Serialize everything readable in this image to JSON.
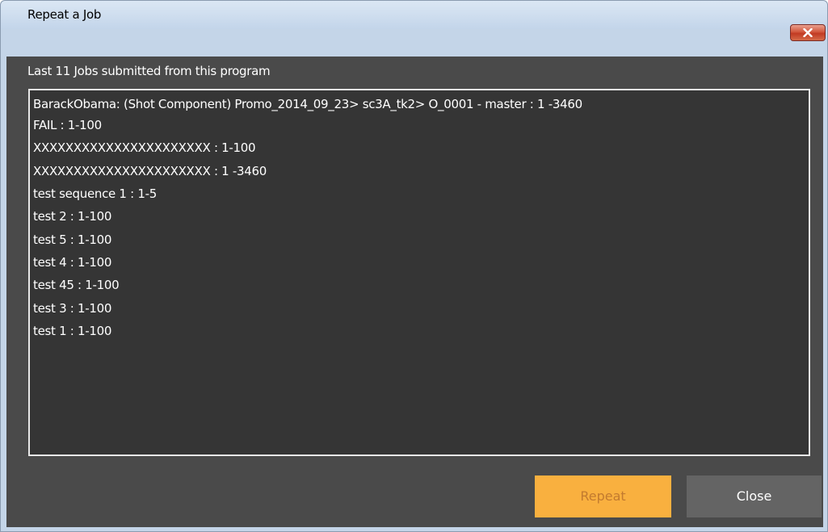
{
  "window": {
    "title": "Repeat a Job",
    "close_icon": "close-x-icon"
  },
  "header": {
    "label": "Last 11 Jobs submitted from this program"
  },
  "jobs": [
    "BarackObama: (Shot Component) Promo_2014_09_23> sc3A_tk2> O_0001 - master : 1 -3460",
    "FAIL : 1-100",
    "XXXXXXXXXXXXXXXXXXXXXX : 1-100",
    "XXXXXXXXXXXXXXXXXXXXXX : 1 -3460",
    "test sequence 1 : 1-5",
    "test 2 : 1-100",
    "test 5 : 1-100",
    "test 4 : 1-100",
    "test 45 : 1-100",
    "test 3 : 1-100",
    "test 1 : 1-100"
  ],
  "buttons": {
    "repeat_label": "Repeat",
    "repeat_state": "disabled",
    "close_label": "Close"
  },
  "colors": {
    "repeat_bg": "#f9b03f",
    "close_bg": "#646464",
    "panel_bg": "#4a4a4a",
    "list_bg": "#353535"
  }
}
